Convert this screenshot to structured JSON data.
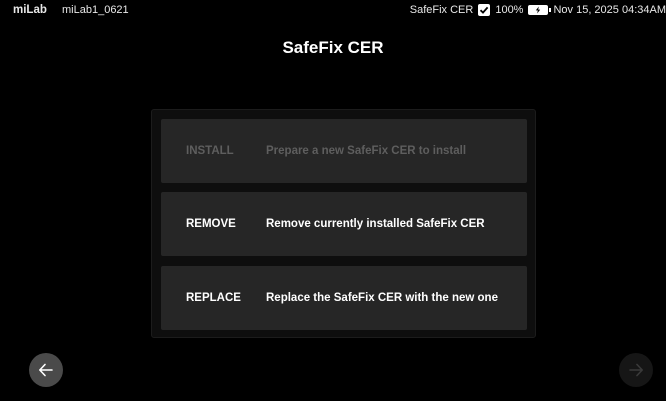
{
  "statusbar": {
    "brand": "miLab",
    "device_id": "miLab1_0621",
    "product_label": "SafeFix CER",
    "battery_percent": "100%",
    "datetime": "Nov 15, 2025 04:34AM",
    "icons": [
      "checkbox-checked-icon",
      "battery-charging-icon"
    ]
  },
  "page": {
    "title": "SafeFix CER"
  },
  "options": [
    {
      "label": "INSTALL",
      "description": "Prepare a new SafeFix CER to install",
      "enabled": false
    },
    {
      "label": "REMOVE",
      "description": "Remove currently installed SafeFix CER",
      "enabled": true
    },
    {
      "label": "REPLACE",
      "description": "Replace the SafeFix CER with the new one",
      "enabled": true
    }
  ],
  "navigation": {
    "back_icon": "arrow-left-icon",
    "next_icon": "arrow-right-icon",
    "next_enabled": false
  },
  "colors": {
    "background": "#000000",
    "option_background": "#262626",
    "disabled_text": "#5e5e5e",
    "text": "#ffffff"
  }
}
